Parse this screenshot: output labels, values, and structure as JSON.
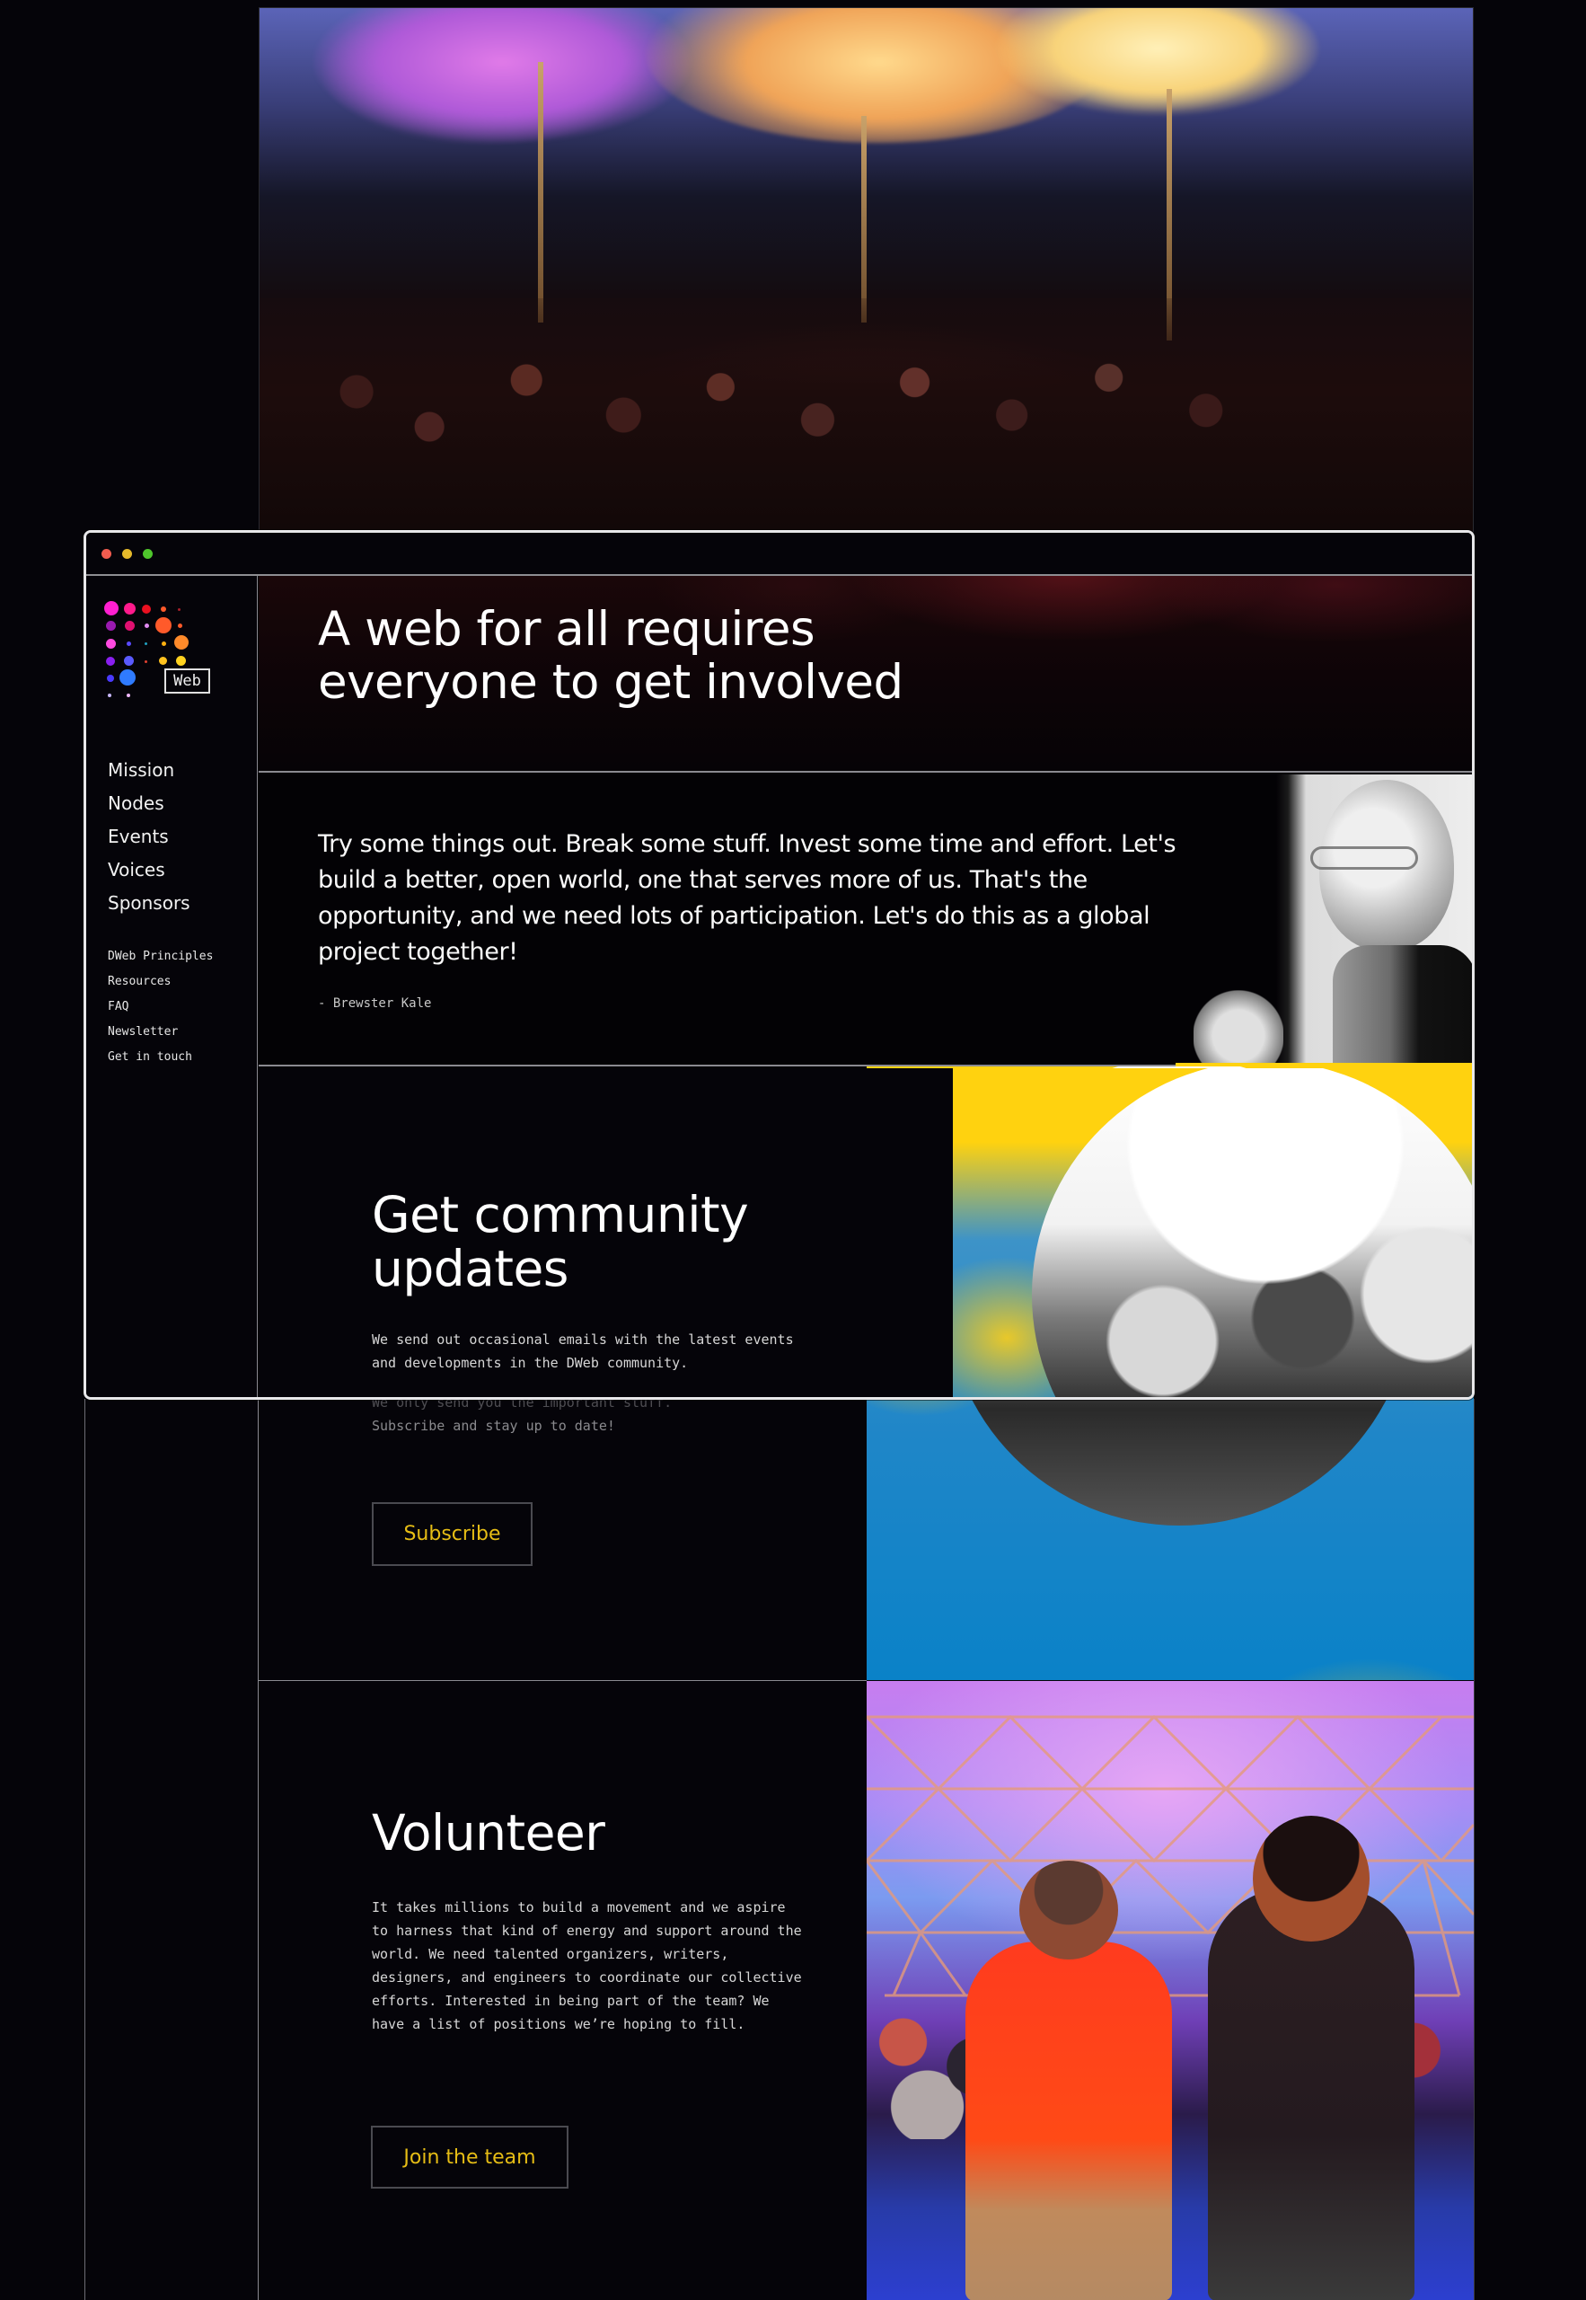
{
  "window": {
    "controls": [
      "close",
      "minimize",
      "maximize"
    ]
  },
  "brand": {
    "badge_text": "Web",
    "logo_dot_colors": [
      "#ff1fd0",
      "#ff1a8c",
      "#ea1020",
      "#ff5a2a",
      "#ff5a2a",
      "#ff8a2a",
      "#ffd21f",
      "#8a1ff0",
      "#5a5aff",
      "#2f7bff",
      "#d8a8ff"
    ]
  },
  "sidebar": {
    "main_nav": [
      {
        "label": "Mission"
      },
      {
        "label": "Nodes"
      },
      {
        "label": "Events"
      },
      {
        "label": "Voices"
      },
      {
        "label": "Sponsors"
      }
    ],
    "secondary_nav": [
      {
        "label": "DWeb Principles"
      },
      {
        "label": "Resources"
      },
      {
        "label": "FAQ"
      },
      {
        "label": "Newsletter"
      },
      {
        "label": "Get in touch"
      }
    ]
  },
  "hero": {
    "headline_line1": "A web for all requires",
    "headline_line2": "everyone to get involved"
  },
  "quote": {
    "text": "Try some things out. Break some stuff. Invest some time and effort. Let's build a better, open world, one that serves more of us. That's the opportunity, and we need lots of participation. Let's do this as a global project together!",
    "author": "- Brewster Kale"
  },
  "community": {
    "title_line1": "Get community",
    "title_line2": "updates",
    "body_visible": "We send out occasional emails with the latest events and developments in the DWeb community.",
    "body_continued_line1": "We only send you the important stuff.",
    "body_continued_line2": "Subscribe and stay up to date!",
    "button_label": "Subscribe"
  },
  "volunteer": {
    "title": "Volunteer",
    "body": "It takes millions to build a movement and we aspire to harness that kind of energy and support around the world. We need talented organizers, writers, designers, and engineers to coordinate our collective efforts. Interested in being part of the team?  We have a list of positions we’re hoping to fill.",
    "button_label": "Join the team"
  },
  "colors": {
    "page_bg": "#050409",
    "accent_button_text": "#e6bd15",
    "traffic_red": "#f25c4f",
    "traffic_yellow": "#e5b92b",
    "traffic_green": "#4fc62c",
    "community_yellow": "#ffd20f",
    "community_blue": "#1f86c8"
  }
}
